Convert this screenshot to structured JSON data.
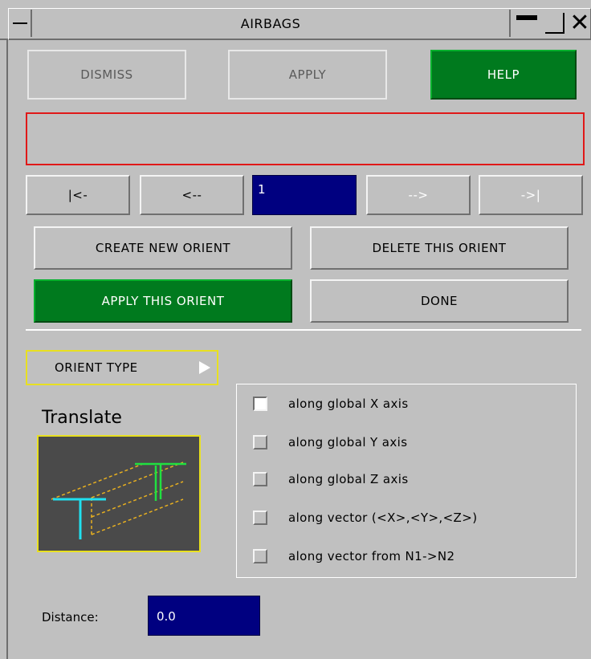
{
  "window": {
    "title": "AIRBAGS"
  },
  "toolbar": {
    "dismiss_label": "DISMISS",
    "apply_label": "APPLY",
    "help_label": "HELP"
  },
  "message": {
    "text": ""
  },
  "nav": {
    "first_label": "|<-",
    "prev_label": "<--",
    "index_value": "1",
    "next_label": "-->",
    "last_label": "->|"
  },
  "actions": {
    "create_label": "CREATE NEW ORIENT",
    "delete_label": "DELETE THIS ORIENT",
    "apply_label": "APPLY THIS ORIENT",
    "done_label": "DONE"
  },
  "orient": {
    "type_label": "ORIENT TYPE",
    "mode_label": "Translate",
    "options": [
      {
        "label": "along global X axis",
        "checked": true
      },
      {
        "label": "along global Y axis",
        "checked": false
      },
      {
        "label": "along global Z axis",
        "checked": false
      },
      {
        "label": "along vector (<X>,<Y>,<Z>)",
        "checked": false
      },
      {
        "label": "along vector from N1->N2",
        "checked": false
      }
    ]
  },
  "distance": {
    "label": "Distance:",
    "value": "0.0"
  },
  "colors": {
    "panel_bg": "#c0c0c0",
    "accent_green": "#007a1e",
    "field_blue": "#000080",
    "highlight_yellow": "#e8e020",
    "message_border_red": "#e01818",
    "preview_bg": "#4a4a4a"
  },
  "icons": {
    "orient_type_arrow": "triangle-right-icon",
    "preview_image": "translate-beam-icon",
    "system_menu": "system-menu-icon",
    "minimize": "minimize-icon",
    "maximize": "maximize-icon",
    "close": "close-icon"
  }
}
